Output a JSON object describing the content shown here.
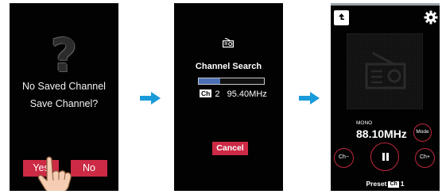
{
  "screen1": {
    "icon": "question-mark-icon",
    "icon_glyph": "?",
    "message_line1": "No Saved Channel",
    "message_line2": "Save Channel?",
    "yes_label": "Yes",
    "no_label": "No"
  },
  "screen2": {
    "icon": "radio-icon",
    "title": "Channel Search",
    "search_progress": 0.33,
    "channel_badge": "Ch",
    "channel_number": "2",
    "frequency": "95.40MHz",
    "cancel_label": "Cancel"
  },
  "screen3": {
    "back_icon": "back-arrow-icon",
    "settings_icon": "gear-icon",
    "station_art_icon": "radio-icon",
    "audio_mode": "MONO",
    "frequency": "88.10MHz",
    "mode_label": "Mode",
    "ch_down_label": "Ch−",
    "ch_up_label": "Ch+",
    "play_state_icon": "pause-icon",
    "preset_label": "Preset",
    "preset_badge": "Ch",
    "preset_number": "1"
  },
  "colors": {
    "accent_red": "#cc2a45",
    "arrow_blue": "#1a9ad9",
    "progress_blue": "#4a6fb5",
    "screen_bg": "#020202"
  }
}
